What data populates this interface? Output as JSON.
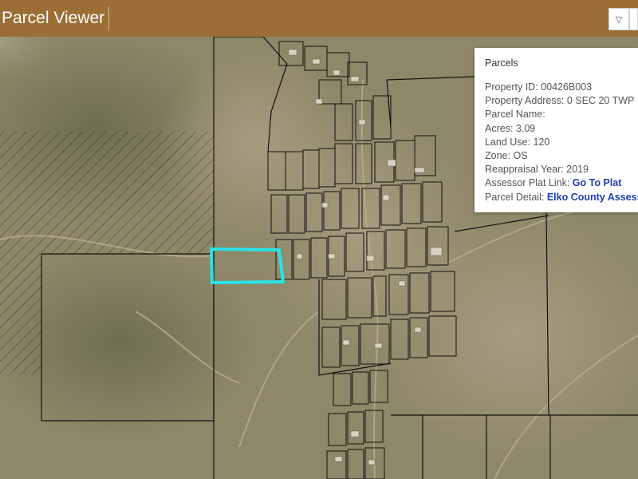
{
  "app": {
    "title": "Parcel Viewer"
  },
  "header_buttons": {
    "dropdown_icon": "▽",
    "second_icon": "□"
  },
  "popup": {
    "title": "Parcels",
    "fields": [
      {
        "label": "Property ID:",
        "value": "00426B003"
      },
      {
        "label": "Property Address:",
        "value": "0 SEC 20 TWP"
      },
      {
        "label": "Parcel Name:",
        "value": ""
      },
      {
        "label": "Acres:",
        "value": "3.09"
      },
      {
        "label": "Land Use:",
        "value": "120"
      },
      {
        "label": "Zone:",
        "value": "OS"
      },
      {
        "label": "Reappraisal Year:",
        "value": "2019"
      }
    ],
    "links": [
      {
        "label": "Assessor Plat Link:",
        "value": "Go To Plat"
      },
      {
        "label": "Parcel Detail:",
        "value": "Elko County Assess"
      }
    ]
  },
  "map": {
    "colors": {
      "terrain": "#8c8466",
      "parcel_line": "#111111",
      "selected_parcel": "#27e3e8",
      "hatch": "#222222"
    }
  }
}
